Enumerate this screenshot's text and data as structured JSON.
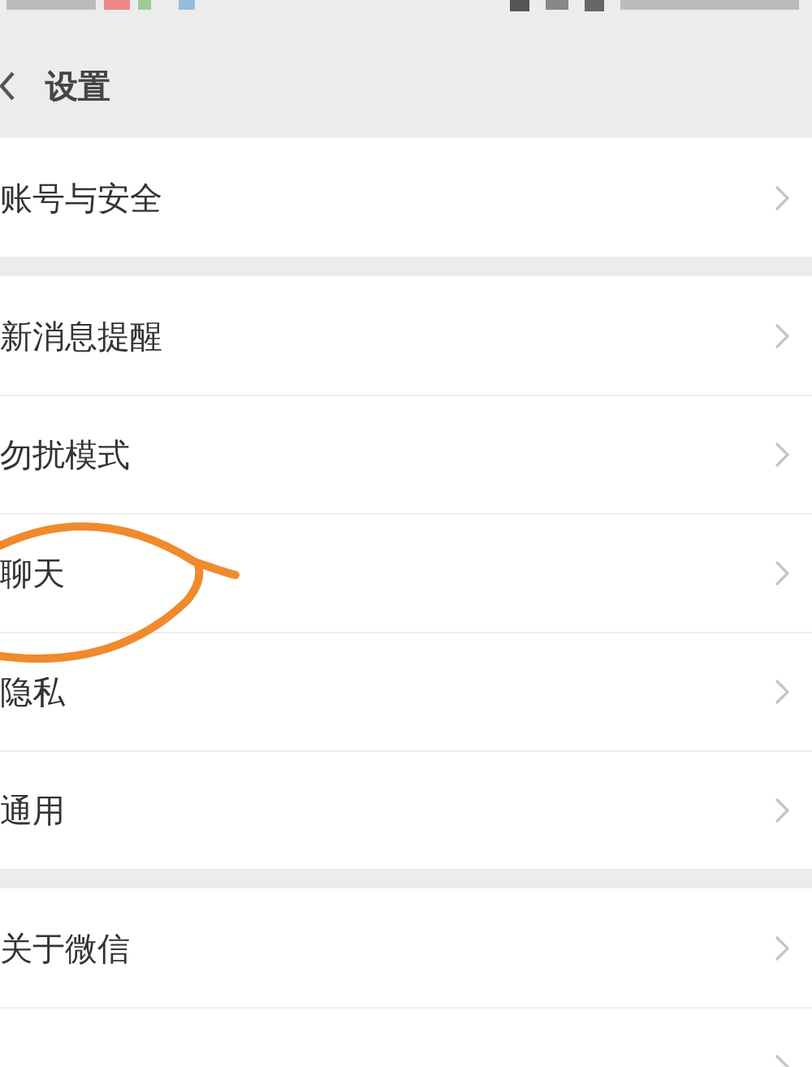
{
  "nav_bar": {
    "title": "设置"
  },
  "groups": [
    {
      "items": [
        {
          "label": "账号与安全"
        }
      ]
    },
    {
      "items": [
        {
          "label": "新消息提醒"
        },
        {
          "label": "勿扰模式"
        },
        {
          "label": "聊天"
        },
        {
          "label": "隐私"
        },
        {
          "label": "通用"
        }
      ]
    },
    {
      "items": [
        {
          "label": "关于微信"
        }
      ],
      "more_below": true
    }
  ]
}
